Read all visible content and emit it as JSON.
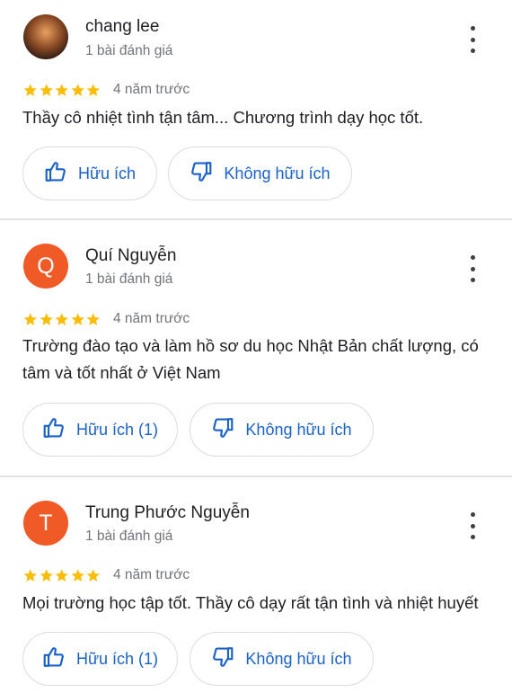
{
  "colors": {
    "accent": "#1a62c9",
    "star": "#fbbc04",
    "avatar_letter_bg": "#ef5a27",
    "muted": "#70757a"
  },
  "reviews": [
    {
      "avatar_type": "photo",
      "avatar_letter": "",
      "name": "chang lee",
      "review_count": "1 bài đánh giá",
      "rating": 5,
      "time": "4 năm trước",
      "text": "Thầy cô nhiệt tình tận tâm... Chương trình dạy học tốt.",
      "helpful_label": "Hữu ích",
      "not_helpful_label": "Không hữu ích"
    },
    {
      "avatar_type": "letter",
      "avatar_letter": "Q",
      "name": "Quí Nguyễn",
      "review_count": "1 bài đánh giá",
      "rating": 5,
      "time": "4 năm trước",
      "text": "Trường đào tạo và làm hồ sơ du học Nhật Bản chất lượng, có tâm và tốt nhất ở Việt Nam",
      "helpful_label": "Hữu ích (1)",
      "not_helpful_label": "Không hữu ích"
    },
    {
      "avatar_type": "letter",
      "avatar_letter": "T",
      "name": "Trung Phước Nguyễn",
      "review_count": "1 bài đánh giá",
      "rating": 5,
      "time": "4 năm trước",
      "text": "Mọi trường học tập tốt. Thầy cô dạy rất tận tình và nhiệt huyết",
      "helpful_label": "Hữu ích (1)",
      "not_helpful_label": "Không hữu ích"
    }
  ]
}
